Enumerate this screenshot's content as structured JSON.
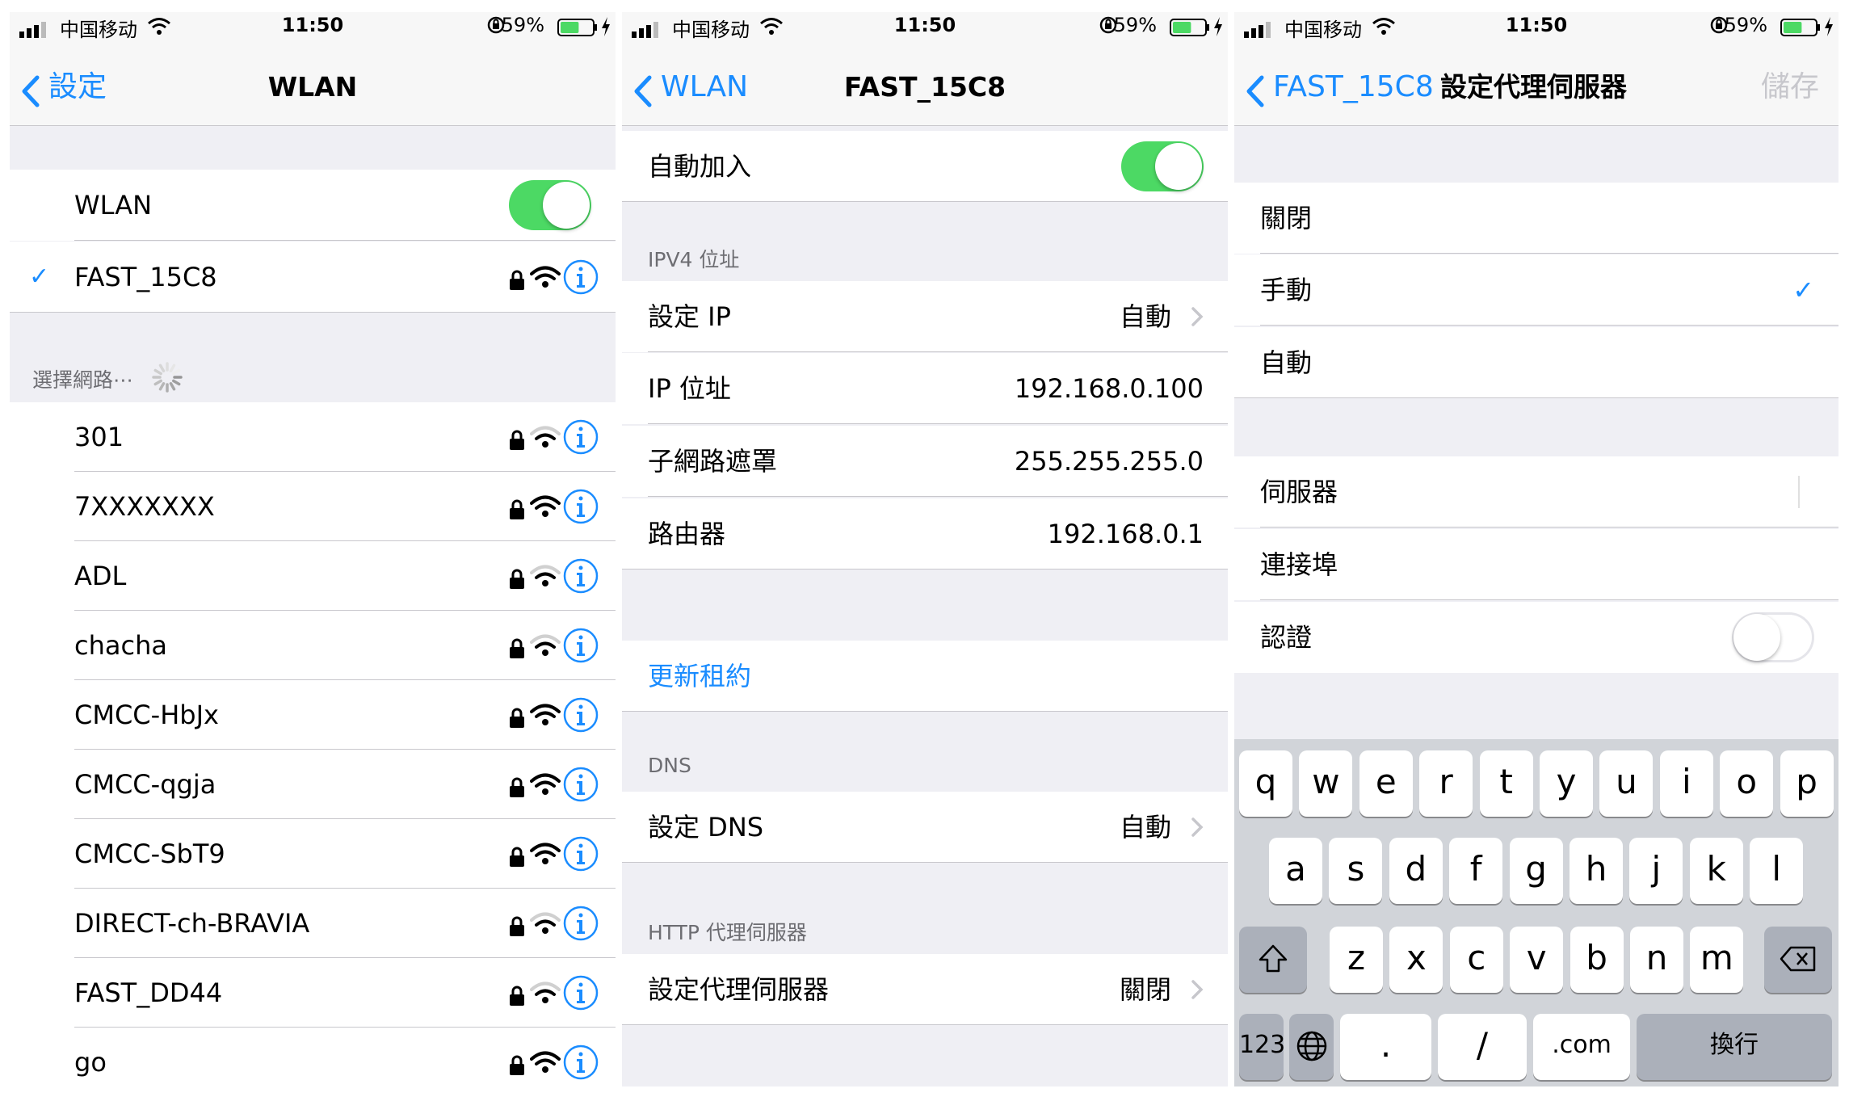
{
  "colors": {
    "accent": "#1a8cff",
    "switch_on": "#4cd964",
    "battery": "#4cd964",
    "group_bg": "#efeff4"
  },
  "status_bar": {
    "carrier": "中国移动",
    "time": "11:50",
    "battery": "59%"
  },
  "panel1": {
    "back_label": "設定",
    "title": "WLAN",
    "wlan_label": "WLAN",
    "wlan_on": true,
    "connected": {
      "name": "FAST_15C8",
      "check": "✓"
    },
    "choose_header": "選擇網路⋯",
    "networks": [
      {
        "name": "301",
        "secured": true,
        "signal": "medium"
      },
      {
        "name": "7XXXXXXX",
        "secured": true,
        "signal": "full"
      },
      {
        "name": "ADL",
        "secured": true,
        "signal": "medium"
      },
      {
        "name": "chacha",
        "secured": true,
        "signal": "medium"
      },
      {
        "name": "CMCC-HbJx",
        "secured": true,
        "signal": "full"
      },
      {
        "name": "CMCC-qgja",
        "secured": true,
        "signal": "full"
      },
      {
        "name": "CMCC-SbT9",
        "secured": true,
        "signal": "full"
      },
      {
        "name": "DIRECT-ch-BRAVIA",
        "secured": true,
        "signal": "medium"
      },
      {
        "name": "FAST_DD44",
        "secured": true,
        "signal": "medium"
      },
      {
        "name": "go",
        "secured": true,
        "signal": "full"
      }
    ]
  },
  "panel2": {
    "back_label": "WLAN",
    "title": "FAST_15C8",
    "auto_join_label": "自動加入",
    "auto_join_on": true,
    "ipv4_header": "IPV4 位址",
    "configure_ip_label": "設定 IP",
    "configure_ip_value": "自動",
    "ip_label": "IP 位址",
    "ip_value": "192.168.0.100",
    "subnet_label": "子網路遮罩",
    "subnet_value": "255.255.255.0",
    "router_label": "路由器",
    "router_value": "192.168.0.1",
    "renew_label": "更新租約",
    "dns_header": "DNS",
    "configure_dns_label": "設定 DNS",
    "configure_dns_value": "自動",
    "proxy_header": "HTTP 代理伺服器",
    "configure_proxy_label": "設定代理伺服器",
    "configure_proxy_value": "關閉"
  },
  "panel3": {
    "back_label": "FAST_15C8",
    "title": "設定代理伺服器",
    "save_label": "儲存",
    "options": [
      {
        "label": "關閉",
        "selected": false
      },
      {
        "label": "手動",
        "selected": true
      },
      {
        "label": "自動",
        "selected": false
      }
    ],
    "check": "✓",
    "server_label": "伺服器",
    "port_label": "連接埠",
    "auth_label": "認證",
    "auth_on": false,
    "keyboard": {
      "row1": [
        "q",
        "w",
        "e",
        "r",
        "t",
        "y",
        "u",
        "i",
        "o",
        "p"
      ],
      "row2": [
        "a",
        "s",
        "d",
        "f",
        "g",
        "h",
        "j",
        "k",
        "l"
      ],
      "row3": [
        "z",
        "x",
        "c",
        "v",
        "b",
        "n",
        "m"
      ],
      "num_key": "123",
      "dot_key": ".",
      "slash_key": "/",
      "com_key": ".com",
      "return_key": "換行"
    }
  }
}
